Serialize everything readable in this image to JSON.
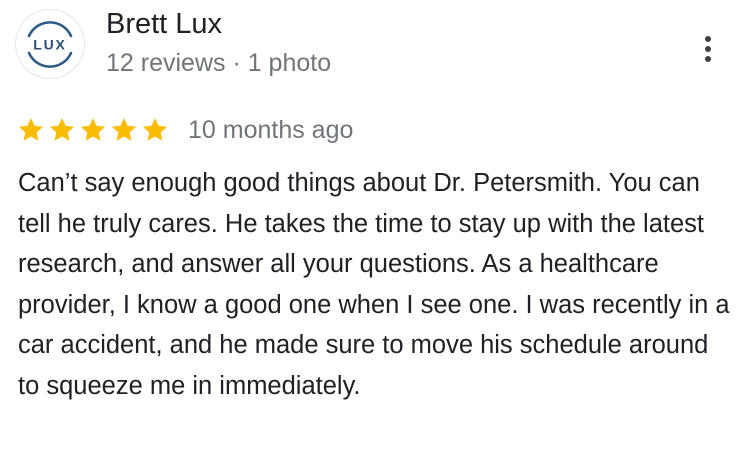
{
  "reviewer": {
    "name": "Brett Lux",
    "avatar_text": "LUX",
    "meta": "12 reviews · 1 photo"
  },
  "rating": {
    "stars": 5,
    "max_stars": 5,
    "star_color": "#fbbc04",
    "time_ago": "10 months ago"
  },
  "review": {
    "text": "Can’t say enough good things about Dr. Petersmith. You can tell he truly cares. He takes the time to stay up with the latest research, and answer all your questions. As a healthcare provider, I know a good one when I see one. I was recently in a car accident, and he made sure to move his schedule around to squeeze me in immediately."
  },
  "colors": {
    "text_primary": "#202124",
    "text_secondary": "#70757a",
    "avatar_ring": "#2e5a88"
  },
  "icons": {
    "menu": "more-vert-icon",
    "star": "star-icon"
  }
}
